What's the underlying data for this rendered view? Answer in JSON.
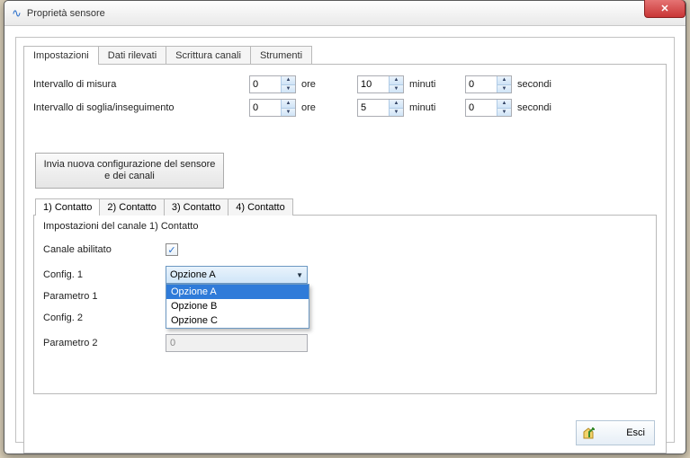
{
  "window": {
    "title": "Proprietà sensore"
  },
  "tabs": [
    {
      "label": "Impostazioni"
    },
    {
      "label": "Dati rilevati"
    },
    {
      "label": "Scrittura canali"
    },
    {
      "label": "Strumenti"
    }
  ],
  "intervals": {
    "measure": {
      "label": "Intervallo di misura",
      "hours": "0",
      "minutes": "10",
      "seconds": "0"
    },
    "threshold": {
      "label": "Intervallo di soglia/inseguimento",
      "hours": "0",
      "minutes": "5",
      "seconds": "0"
    },
    "units": {
      "hours": "ore",
      "minutes": "minuti",
      "seconds": "secondi"
    }
  },
  "send_button": "Invia nuova configurazione del sensore e dei canali",
  "channel_tabs": [
    {
      "label": "1) Contatto"
    },
    {
      "label": "2) Contatto"
    },
    {
      "label": "3) Contatto"
    },
    {
      "label": "4) Contatto"
    }
  ],
  "channel": {
    "legend": "Impostazioni del canale 1) Contatto",
    "enabled_label": "Canale abilitato",
    "enabled": true,
    "config1_label": "Config. 1",
    "config1_value": "Opzione A",
    "config1_options": [
      "Opzione A",
      "Opzione B",
      "Opzione C"
    ],
    "param1_label": "Parametro 1",
    "param1_value": "",
    "config2_label": "Config. 2",
    "param2_label": "Parametro 2",
    "param2_value": "0"
  },
  "footer": {
    "exit": "Esci"
  }
}
